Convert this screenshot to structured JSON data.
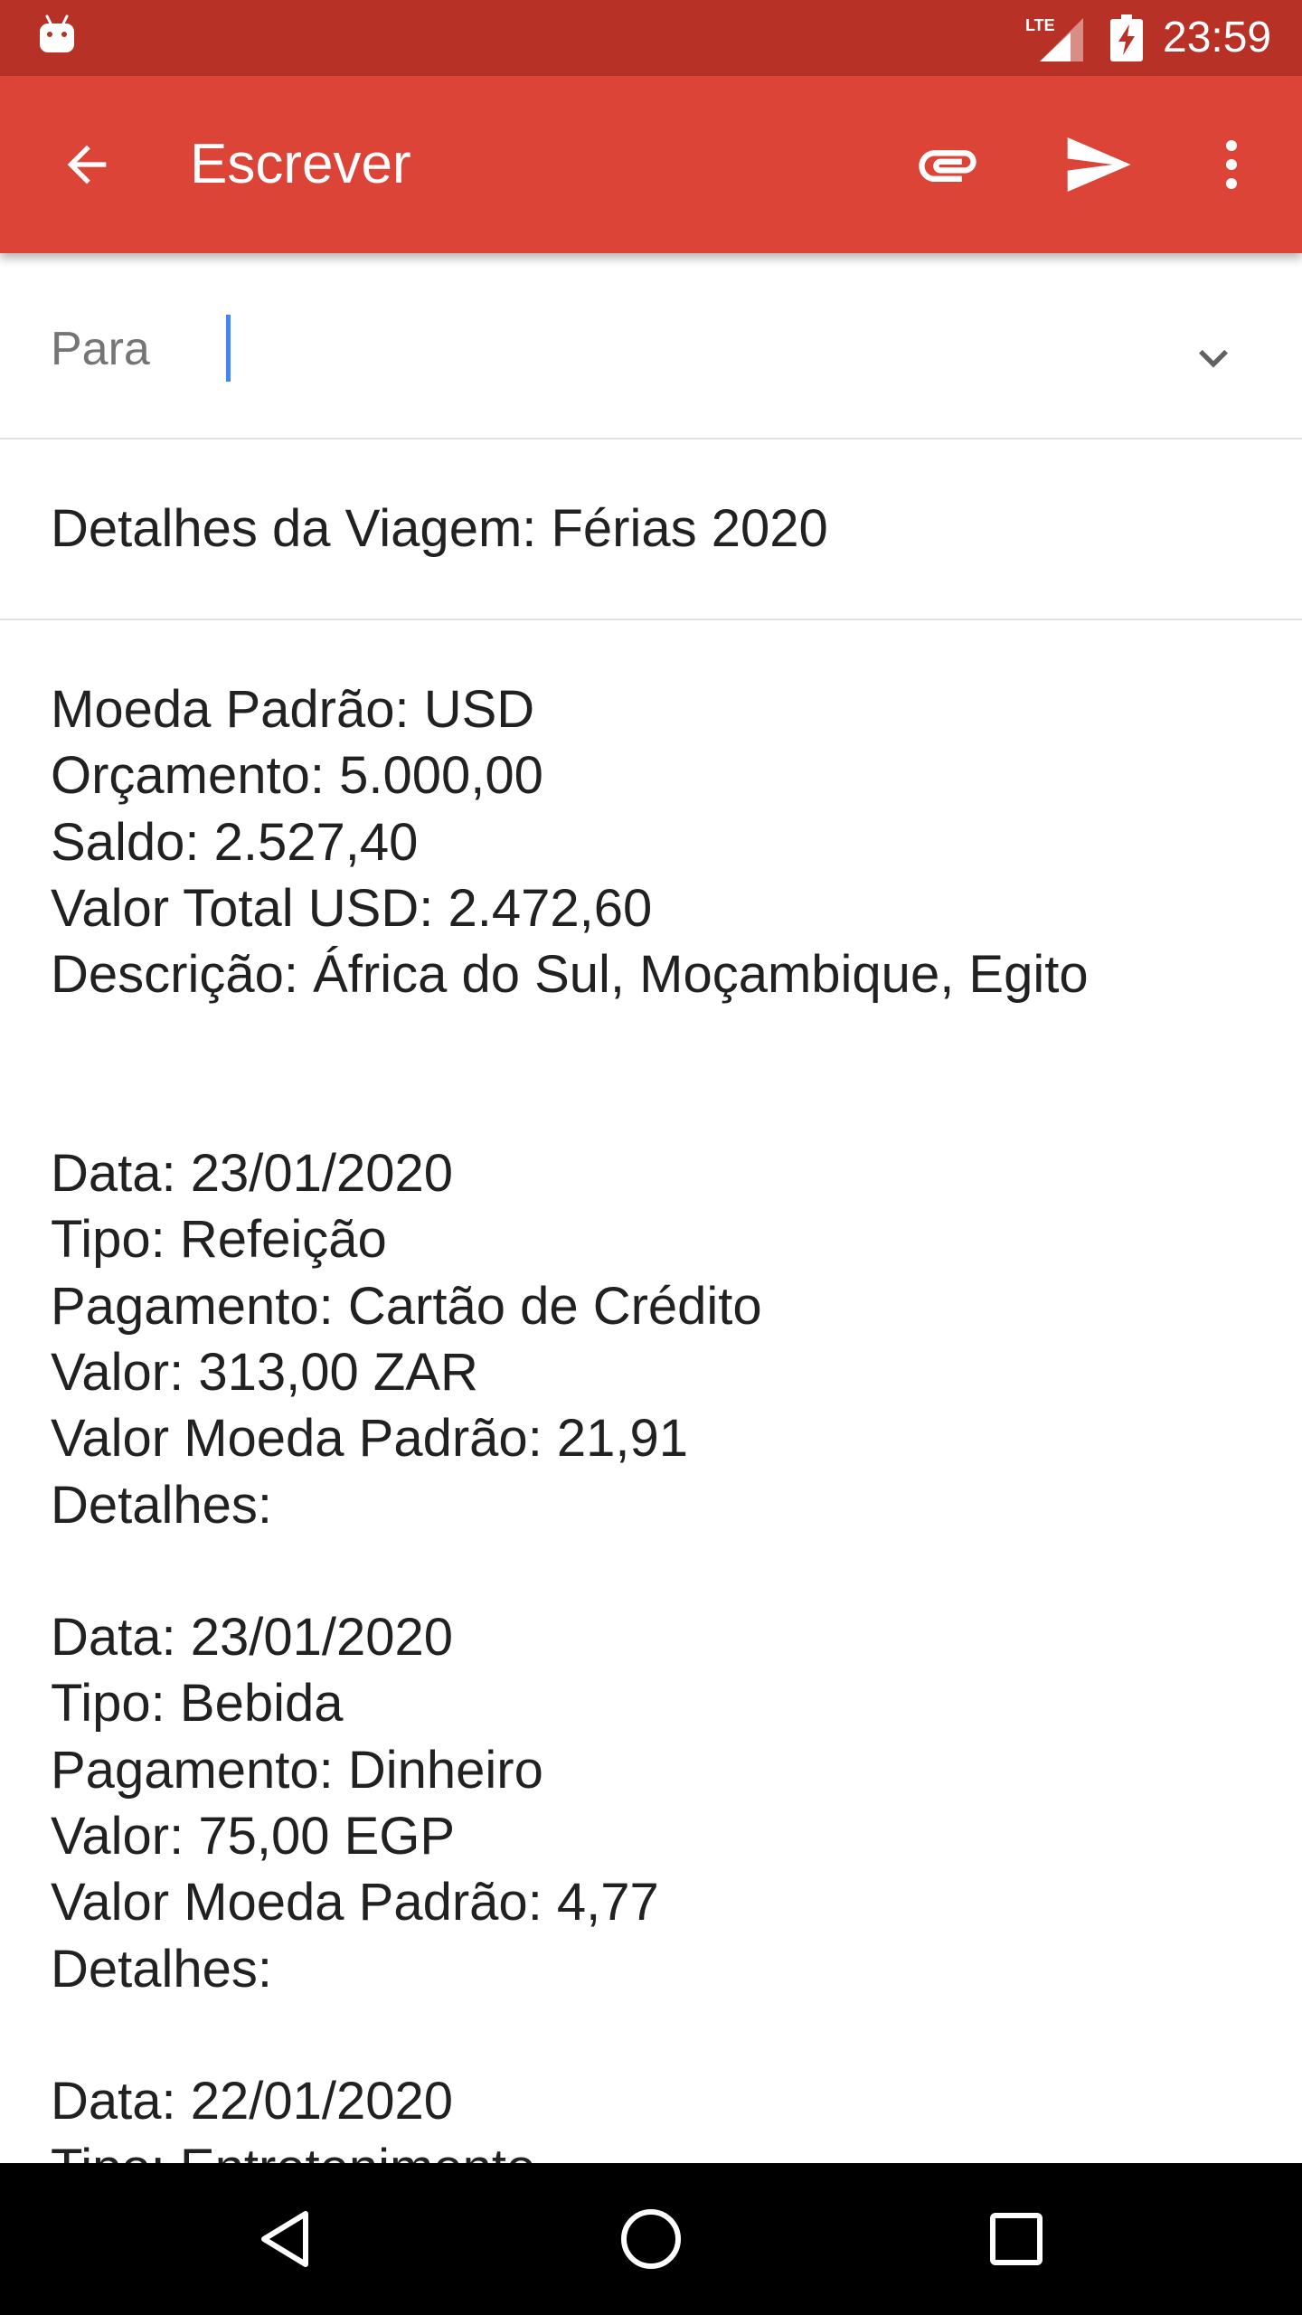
{
  "status_bar": {
    "time": "23:59",
    "network_label": "LTE",
    "icons": [
      "android-debug-icon",
      "lte-signal-icon",
      "battery-charging-icon"
    ]
  },
  "app_bar": {
    "title": "Escrever",
    "icons": [
      "back-arrow-icon",
      "attach-icon",
      "send-icon",
      "more-vert-icon"
    ]
  },
  "compose": {
    "to_label": "Para",
    "to_value": "",
    "subject": "Detalhes da Viagem: Férias 2020",
    "body_lines": [
      "Moeda Padrão: USD",
      "Orçamento: 5.000,00",
      "Saldo: 2.527,40",
      "Valor Total USD: 2.472,60",
      "Descrição: África do Sul, Moçambique, Egito",
      "",
      "",
      "Data: 23/01/2020",
      "Tipo: Refeição",
      "Pagamento: Cartão de Crédito",
      "Valor: 313,00 ZAR",
      "Valor Moeda Padrão: 21,91",
      "Detalhes:",
      "",
      "Data: 23/01/2020",
      "Tipo: Bebida",
      "Pagamento: Dinheiro",
      "Valor: 75,00 EGP",
      "Valor Moeda Padrão: 4,77",
      "Detalhes:",
      "",
      "Data: 22/01/2020",
      "Tipo: Entretenimento"
    ]
  },
  "nav_bar": {
    "icons": [
      "nav-back-icon",
      "nav-home-icon",
      "nav-recents-icon"
    ]
  },
  "colors": {
    "status_bar": "#B83126",
    "app_bar": "#DB4437",
    "cursor": "#4285F4"
  }
}
